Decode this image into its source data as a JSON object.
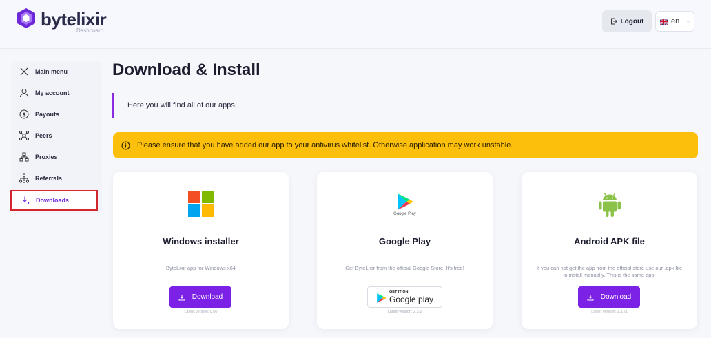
{
  "brand": {
    "name": "bytelixir",
    "subtitle": "Dashboard",
    "color": "#6d28d9"
  },
  "header": {
    "logout_label": "Logout",
    "language": "en"
  },
  "sidebar": {
    "items": [
      {
        "label": "Main menu",
        "icon": "close-icon"
      },
      {
        "label": "My account",
        "icon": "user-icon"
      },
      {
        "label": "Payouts",
        "icon": "dollar-icon"
      },
      {
        "label": "Peers",
        "icon": "peers-icon"
      },
      {
        "label": "Proxies",
        "icon": "network-icon"
      },
      {
        "label": "Referrals",
        "icon": "referrals-icon"
      },
      {
        "label": "Downloads",
        "icon": "download-icon",
        "active": true
      }
    ]
  },
  "main": {
    "title": "Download & Install",
    "intro": "Here you will find all of our apps.",
    "alert": "Please ensure that you have added our app to your antivirus whitelist. Otherwise application may work unstable.",
    "alert_color": "#fbbf0c",
    "cards": [
      {
        "title": "Windows installer",
        "description": "ByteLixir app for Windows x64",
        "button": "Download",
        "latest": "Latest version: 0.60",
        "icon": "windows-logo-icon"
      },
      {
        "title": "Google Play",
        "icon_caption": "Google Play",
        "description": "Get ByteLixir from the official Google Store. It's free!",
        "badge_small": "GET IT ON",
        "badge_big": "Google play",
        "latest": "Latest version: 2.3.2",
        "icon": "google-play-logo-icon"
      },
      {
        "title": "Android APK file",
        "description": "If you can not get the app from the official store use our .apk file to install manually. This is the same app.",
        "button": "Download",
        "latest": "Latest version: 2.3.21",
        "icon": "android-logo-icon"
      }
    ]
  }
}
